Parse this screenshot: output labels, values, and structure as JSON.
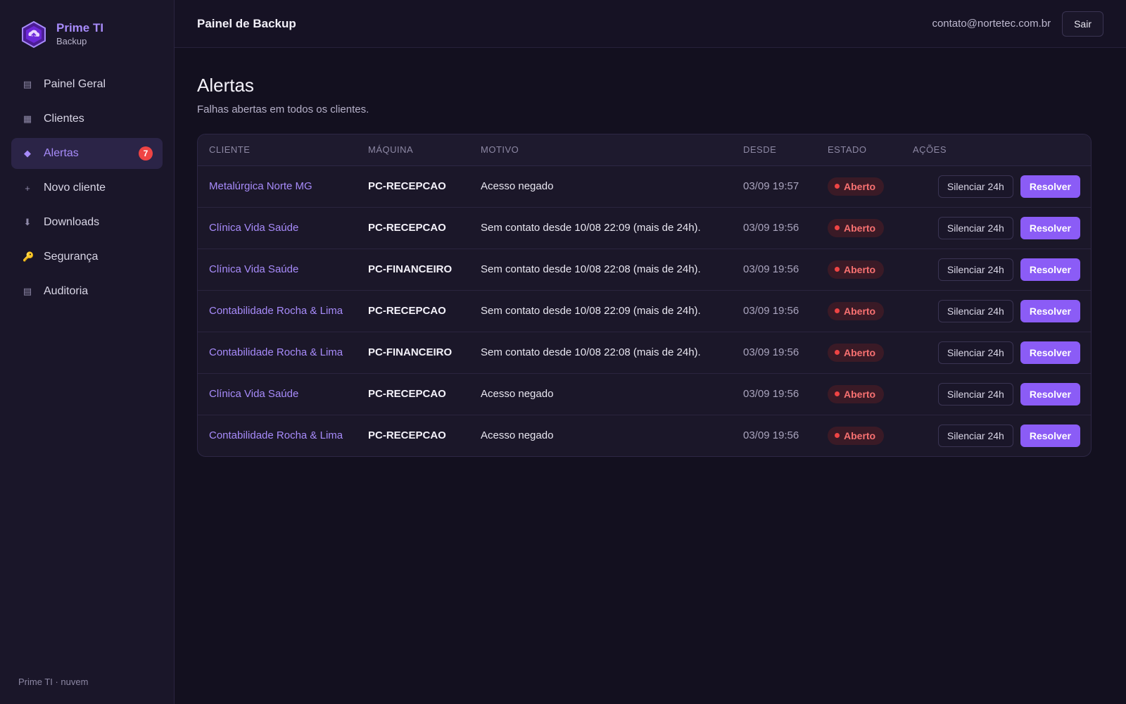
{
  "brand": {
    "name": "Prime TI",
    "subtitle": "Backup"
  },
  "sidebar": {
    "items": [
      {
        "label": "Painel Geral",
        "icon": "list-icon",
        "glyph": "▤"
      },
      {
        "label": "Clientes",
        "icon": "grid-icon",
        "glyph": "▦"
      },
      {
        "label": "Alertas",
        "icon": "diamond-icon",
        "glyph": "◆",
        "badge": "7",
        "active": true
      },
      {
        "label": "Novo cliente",
        "icon": "plus-icon",
        "glyph": "+"
      },
      {
        "label": "Downloads",
        "icon": "download-icon",
        "glyph": "⬇"
      },
      {
        "label": "Segurança",
        "icon": "key-icon",
        "glyph": "🔑"
      },
      {
        "label": "Auditoria",
        "icon": "list-icon",
        "glyph": "▤"
      }
    ],
    "footer": "Prime TI · nuvem"
  },
  "topbar": {
    "title": "Painel de Backup",
    "email": "contato@nortetec.com.br",
    "logout_label": "Sair"
  },
  "page": {
    "title": "Alertas",
    "subtitle": "Falhas abertas em todos os clientes."
  },
  "table": {
    "headers": {
      "cliente": "CLIENTE",
      "maquina": "MÁQUINA",
      "motivo": "MOTIVO",
      "desde": "DESDE",
      "estado": "ESTADO",
      "acoes": "AÇÕES"
    },
    "silence_label": "Silenciar 24h",
    "resolve_label": "Resolver",
    "rows": [
      {
        "cliente": "Metalúrgica Norte MG",
        "maquina": "PC-RECEPCAO",
        "motivo": "Acesso negado",
        "desde": "03/09 19:57",
        "estado": "Aberto"
      },
      {
        "cliente": "Clínica Vida Saúde",
        "maquina": "PC-RECEPCAO",
        "motivo": "Sem contato desde 10/08 22:09 (mais de 24h).",
        "desde": "03/09 19:56",
        "estado": "Aberto"
      },
      {
        "cliente": "Clínica Vida Saúde",
        "maquina": "PC-FINANCEIRO",
        "motivo": "Sem contato desde 10/08 22:08 (mais de 24h).",
        "desde": "03/09 19:56",
        "estado": "Aberto"
      },
      {
        "cliente": "Contabilidade Rocha & Lima",
        "maquina": "PC-RECEPCAO",
        "motivo": "Sem contato desde 10/08 22:09 (mais de 24h).",
        "desde": "03/09 19:56",
        "estado": "Aberto"
      },
      {
        "cliente": "Contabilidade Rocha & Lima",
        "maquina": "PC-FINANCEIRO",
        "motivo": "Sem contato desde 10/08 22:08 (mais de 24h).",
        "desde": "03/09 19:56",
        "estado": "Aberto"
      },
      {
        "cliente": "Clínica Vida Saúde",
        "maquina": "PC-RECEPCAO",
        "motivo": "Acesso negado",
        "desde": "03/09 19:56",
        "estado": "Aberto"
      },
      {
        "cliente": "Contabilidade Rocha & Lima",
        "maquina": "PC-RECEPCAO",
        "motivo": "Acesso negado",
        "desde": "03/09 19:56",
        "estado": "Aberto"
      }
    ]
  },
  "colors": {
    "accent": "#8b5cf6",
    "accent_text": "#a78bfa",
    "danger": "#ef4444",
    "background": "#13101f",
    "sidebar": "#1a1629"
  }
}
